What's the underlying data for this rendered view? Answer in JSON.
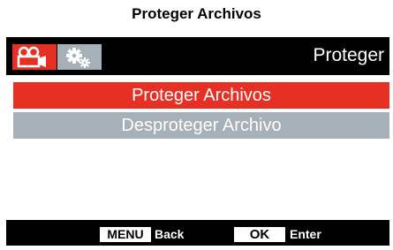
{
  "page_title": "Proteger Archivos",
  "header": {
    "tabs": [
      {
        "icon": "video-camera-icon",
        "active": true
      },
      {
        "icon": "settings-gears-icon",
        "active": false
      }
    ],
    "title": "Proteger"
  },
  "menu": {
    "items": [
      {
        "label": "Proteger Archivos",
        "selected": true
      },
      {
        "label": "Desproteger Archivo",
        "selected": false
      }
    ]
  },
  "footer": {
    "menu_key": "MENU",
    "menu_action": "Back",
    "ok_key": "OK",
    "ok_action": "Enter"
  },
  "colors": {
    "accent_red": "#e53023",
    "inactive_gray": "#a5b0b8",
    "screen_black": "#000000"
  }
}
